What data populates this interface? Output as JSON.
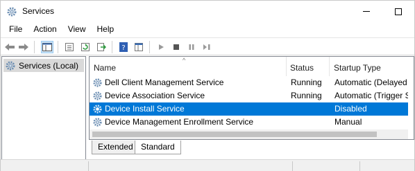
{
  "window": {
    "title": "Services"
  },
  "menu": [
    "File",
    "Action",
    "View",
    "Help"
  ],
  "toolbar": [
    "back-arrow-icon",
    "forward-arrow-icon",
    "show-tree-icon",
    "properties-icon",
    "refresh-icon",
    "export-icon",
    "help-icon",
    "view-icon",
    "start-icon",
    "stop-icon",
    "pause-icon",
    "restart-icon"
  ],
  "tree": {
    "selected_label": "Services (Local)"
  },
  "list": {
    "columns": [
      "Name",
      "Status",
      "Startup Type"
    ],
    "rows": [
      {
        "name": "Dell Client Management Service",
        "status": "Running",
        "startup": "Automatic (Delayed"
      },
      {
        "name": "Device Association Service",
        "status": "Running",
        "startup": "Automatic (Trigger S"
      },
      {
        "name": "Device Install Service",
        "status": "",
        "startup": "Disabled",
        "selected": true
      },
      {
        "name": "Device Management Enrollment Service",
        "status": "",
        "startup": "Manual"
      }
    ]
  },
  "tabs": [
    "Extended",
    "Standard"
  ],
  "active_tab": "Standard",
  "colors": {
    "selection": "#0078d7",
    "toolbar_blue": "#2f5fb3",
    "toolbar_green": "#2c9a3c"
  }
}
